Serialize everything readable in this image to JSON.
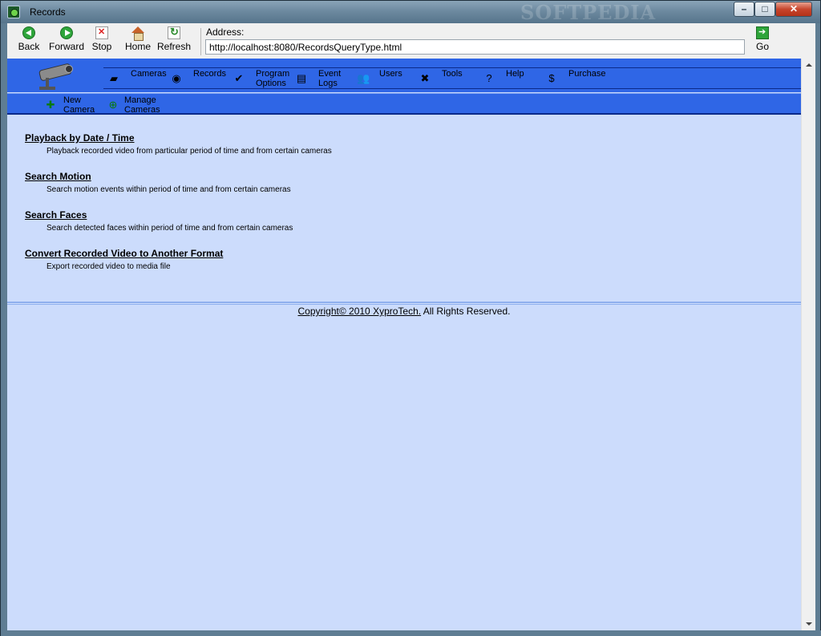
{
  "window": {
    "title": "Records",
    "watermark": "SOFTPEDIA",
    "controls": {
      "minimize": "–",
      "maximize": "□",
      "close": "✕"
    }
  },
  "toolbar": {
    "back": "Back",
    "forward": "Forward",
    "stop": "Stop",
    "home": "Home",
    "refresh": "Refresh",
    "address_label": "Address:",
    "address_value": "http://localhost:8080/RecordsQueryType.html",
    "go": "Go"
  },
  "nav": {
    "items": [
      {
        "icon": "camera-icon",
        "label_line1": "Cameras",
        "label_line2": ""
      },
      {
        "icon": "disc-icon",
        "label_line1": "Records",
        "label_line2": ""
      },
      {
        "icon": "checkmark-icon",
        "label_line1": "Program",
        "label_line2": "Options"
      },
      {
        "icon": "document-icon",
        "label_line1": "Event",
        "label_line2": "Logs"
      },
      {
        "icon": "users-icon",
        "label_line1": "Users",
        "label_line2": ""
      },
      {
        "icon": "tools-icon",
        "label_line1": "Tools",
        "label_line2": ""
      },
      {
        "icon": "help-icon",
        "label_line1": "Help",
        "label_line2": ""
      },
      {
        "icon": "dollar-icon",
        "label_line1": "Purchase",
        "label_line2": ""
      }
    ],
    "sub_items": [
      {
        "icon": "new-camera-icon",
        "label_line1": "New",
        "label_line2": "Camera"
      },
      {
        "icon": "manage-cameras-icon",
        "label_line1": "Manage",
        "label_line2": "Cameras"
      }
    ]
  },
  "entries": [
    {
      "title": "Playback by Date / Time",
      "description": "Playback recorded video from particular period of time and from certain cameras"
    },
    {
      "title": "Search Motion",
      "description": "Search motion events within period of time and from certain cameras"
    },
    {
      "title": "Search Faces",
      "description": "Search detected faces within period of time and from certain cameras"
    },
    {
      "title": "Convert Recorded Video to Another Format",
      "description": "Export recorded video to media file"
    }
  ],
  "footer": {
    "copyright_link": "Copyright© 2010 XyproTech.",
    "rights": " All Rights Reserved."
  },
  "colors": {
    "header_blue": "#2f66e6",
    "page_background": "#ccdcfc"
  }
}
